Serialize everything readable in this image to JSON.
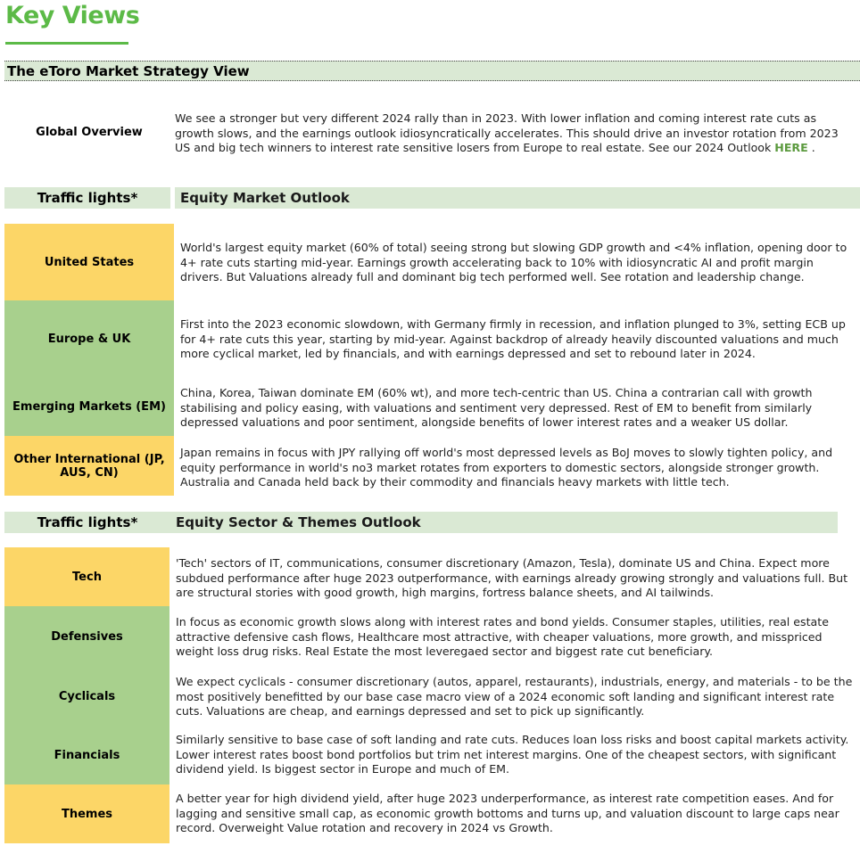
{
  "page_title": "Key Views",
  "strategy": {
    "title": "The eToro Market Strategy View",
    "global_overview": {
      "label": "Global Overview",
      "text": "We see a stronger but very different 2024 rally than in 2023. With lower inflation and coming interest rate cuts as growth slows, and the earnings outlook idiosyncratically accelerates. This should drive an investor rotation from 2023 US and big tech winners to interest rate sensitive losers from Europe to real estate. ",
      "outlook_prefix": "See our 2024 Outlook ",
      "link_label": "HERE",
      "suffix": " ."
    }
  },
  "colors": {
    "brand_green": "#5cba47",
    "section_bg": "#dae9d4",
    "amber": "#fcd667",
    "green": "#a8d08d",
    "link": "#5b9a3e"
  },
  "market_outlook": {
    "traffic_lights_label": "Traffic lights*",
    "title": "Equity Market Outlook",
    "rows": [
      {
        "label": "United States",
        "light": "amber",
        "text": "World's largest equity market (60% of total) seeing strong but slowing GDP growth and <4% inflation, opening door to 4+ rate cuts starting mid-year. Earnings growth accelerating back to 10% with idiosyncratic AI and profit margin drivers. But Valuations already full and dominant big tech performed well. See rotation and leadership change."
      },
      {
        "label": "Europe & UK",
        "light": "green",
        "text": "First into the 2023 economic slowdown, with Germany firmly in recession, and inflation plunged to 3%, setting ECB up for 4+ rate cuts this year, starting by mid-year. Against backdrop of already heavily discounted valuations and much more cyclical market, led by financials, and with earnings depressed and set to rebound later in 2024."
      },
      {
        "label": "Emerging Markets (EM)",
        "light": "green",
        "text": "China, Korea, Taiwan dominate EM (60% wt), and more tech-centric than US. China a contrarian call with growth stabilising and policy easing, with valuations and sentiment very depressed. Rest of EM to benefit from similarly depressed valuations and poor sentiment, alongside benefits of lower interest rates and a weaker US dollar."
      },
      {
        "label": "Other International (JP, AUS, CN)",
        "light": "amber",
        "text": "Japan remains in focus with JPY rallying off world's most depressed levels as BoJ moves to slowly tighten policy, and equity performance in world's no3 market rotates from exporters to domestic sectors, alongside stronger growth. Australia and Canada held back by their commodity and financials heavy markets with little tech."
      }
    ]
  },
  "sector_outlook": {
    "traffic_lights_label": "Traffic lights*",
    "title": "Equity Sector & Themes Outlook",
    "rows": [
      {
        "label": "Tech",
        "light": "amber",
        "text": "'Tech' sectors of IT, communications, consumer discretionary (Amazon, Tesla), dominate US and China. Expect more subdued performance after huge 2023 outperformance, with earnings already growing strongly and valuations full. But are structural stories with good growth, high margins, fortress balance sheets, and AI tailwinds."
      },
      {
        "label": "Defensives",
        "light": "green",
        "text": "In focus as economic growth slows along with interest rates and bond yields. Consumer staples, utilities, real estate attractive defensive cash flows,  Healthcare most attractive, with cheaper valuations, more growth, and misspriced weight loss drug risks. Real Estate the most leveregaed sector and biggest rate cut beneficiary."
      },
      {
        "label": "Cyclicals",
        "light": "green",
        "text": "We expect cyclicals - consumer discretionary (autos, apparel, restaurants), industrials, energy, and materials - to be the most positively benefitted by our base case macro view of a 2024 economic soft landing and significant interest rate cuts. Valuations are cheap, and earnings depressed and set to pick up significantly."
      },
      {
        "label": "Financials",
        "light": "green",
        "text": "Similarly sensitive to base case of soft landing and rate cuts. Reduces loan loss risks and boost capital markets activity. Lower interest rates boost bond portfolios but trim net interest margins. One of the cheapest sectors, with significant dividend yield. Is biggest sector in Europe and much of EM."
      },
      {
        "label": "Themes",
        "light": "amber",
        "text": "A better year for high dividend yield, after huge 2023 underperformance, as interest rate competition eases. And for lagging and sensitive small cap, as economic growth bottoms and turns up, and valuation discount to large caps near record. Overweight Value rotation and recovery in 2024 vs Growth."
      }
    ]
  }
}
